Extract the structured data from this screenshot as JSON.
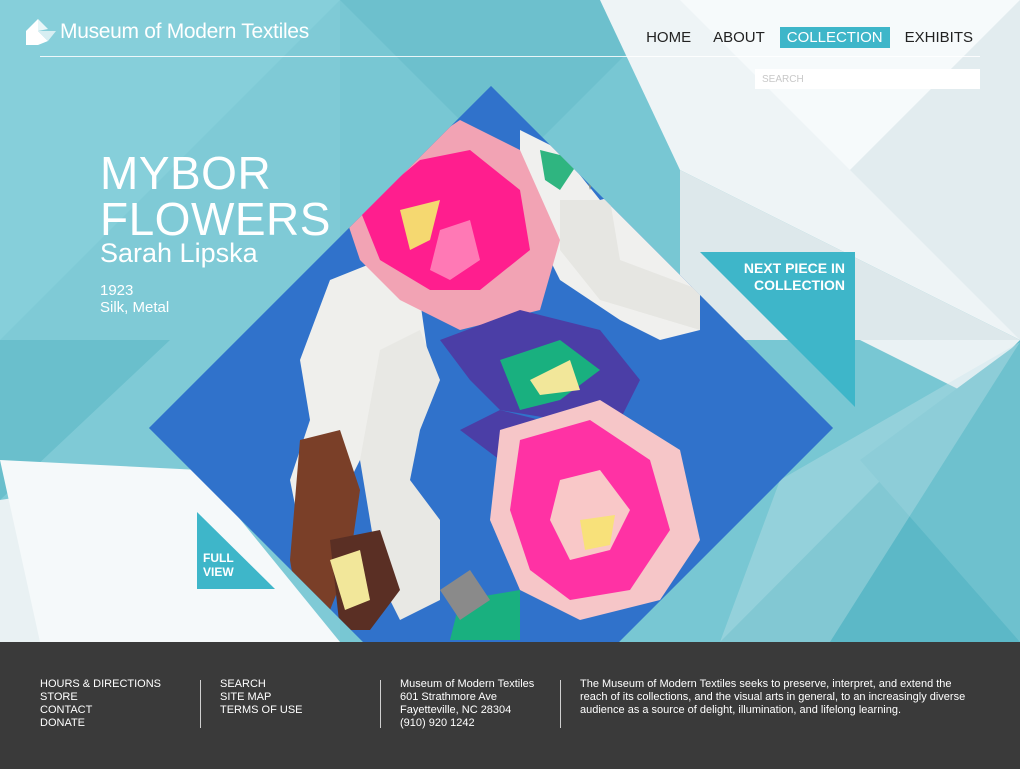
{
  "site": {
    "name": "Museum of Modern Textiles"
  },
  "nav": [
    {
      "label": "HOME",
      "active": false
    },
    {
      "label": "ABOUT",
      "active": false
    },
    {
      "label": "COLLECTION",
      "active": true
    },
    {
      "label": "EXHIBITS",
      "active": false
    }
  ],
  "search": {
    "placeholder": "SEARCH",
    "value": ""
  },
  "artwork": {
    "title": "MYBOR FLOWERS",
    "artist": "Sarah Lipska",
    "year": "1923",
    "materials": "Silk, Metal"
  },
  "buttons": {
    "next_line1": "NEXT PIECE IN",
    "next_line2": "COLLECTION",
    "full_line1": "FULL",
    "full_line2": "VIEW"
  },
  "footer": {
    "links1": [
      "HOURS & DIRECTIONS",
      "STORE",
      "CONTACT",
      "DONATE"
    ],
    "links2": [
      "SEARCH",
      "SITE MAP",
      "TERMS OF USE"
    ],
    "address": [
      "Museum of Modern Textiles",
      "601 Strathmore Ave",
      "Fayetteville, NC 28304",
      "(910) 920 1242"
    ],
    "mission": "The Museum of Modern Textiles seeks to preserve, interpret, and extend the reach of its collections, and the visual arts in general, to an increasingly diverse audience as a source of delight, illumination, and lifelong learning."
  },
  "colors": {
    "accent": "#3eb6c9",
    "background": "#7ccad6",
    "footer": "#3a3a3a",
    "textile_blue": "#2f6fc9",
    "textile_pink": "#ff2e9a"
  }
}
